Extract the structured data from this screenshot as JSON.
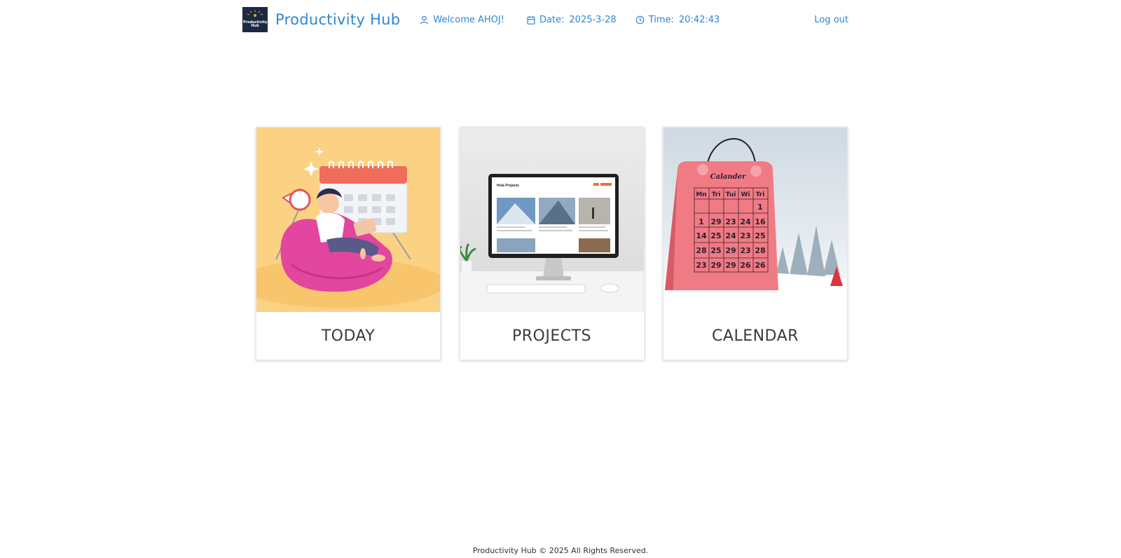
{
  "header": {
    "logo_text": "Productivity Hub",
    "brand": "Productivity Hub",
    "welcome": "Welcome AHOJ!",
    "date_label": "Date:",
    "date_value": "2025-3-28",
    "time_label": "Time:",
    "time_value": "20:42:43",
    "logout": "Log out"
  },
  "cards": [
    {
      "label": "TODAY",
      "image": "person-on-beanbag-with-calendar-illustration"
    },
    {
      "label": "PROJECTS",
      "image": "desktop-monitor-showing-projects-page"
    },
    {
      "label": "CALENDAR",
      "image": "pink-desk-calendar-in-snow"
    }
  ],
  "calendar_image": {
    "title": "Calander",
    "days": [
      "Mn",
      "Tri",
      "Tui",
      "Wi",
      "Tri"
    ],
    "rows": [
      [
        "",
        "",
        "",
        "",
        "1"
      ],
      [
        "1",
        "29",
        "23",
        "24",
        "16"
      ],
      [
        "14",
        "25",
        "24",
        "23",
        "25"
      ],
      [
        "28",
        "25",
        "29",
        "23",
        "28"
      ],
      [
        "23",
        "29",
        "29",
        "26",
        "26"
      ]
    ]
  },
  "monitor_image": {
    "page_heading": "Hola Projects"
  },
  "footer": "Productivity Hub © 2025 All Rights Reserved.",
  "colors": {
    "accent": "#2e86d6",
    "logo_bg": "#1b2a44"
  }
}
